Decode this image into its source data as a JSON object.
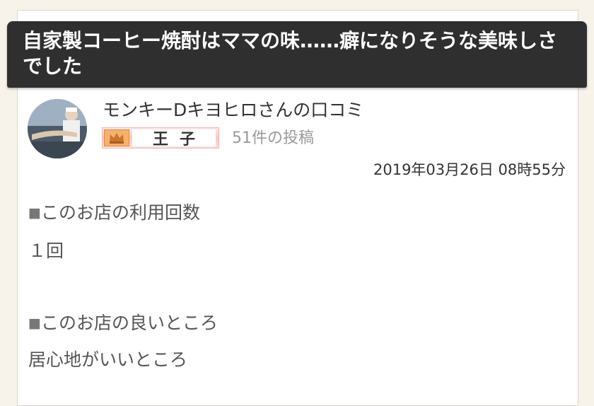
{
  "review": {
    "title": "自家製コーヒー焼酎はママの味……癖になりそうな美味しさでした",
    "reviewer_name": "モンキーDキヨヒロさんの口コミ",
    "rank_label": "王子",
    "post_count": "51件の投稿",
    "date": "2019年03月26日 08時55分",
    "sections": [
      {
        "marker": "■",
        "heading": "このお店の利用回数",
        "body": "１回"
      },
      {
        "marker": "■",
        "heading": "このお店の良いところ",
        "body": "居心地がいいところ"
      }
    ]
  },
  "icons": {
    "avatar": "user-avatar-photo",
    "rank": "crown-icon"
  },
  "colors": {
    "title_bg": "#2f2f2f",
    "badge_pink": "#f6c9c6",
    "crown_orange": "#f4b26e",
    "page_bg": "#f8f3ea"
  }
}
